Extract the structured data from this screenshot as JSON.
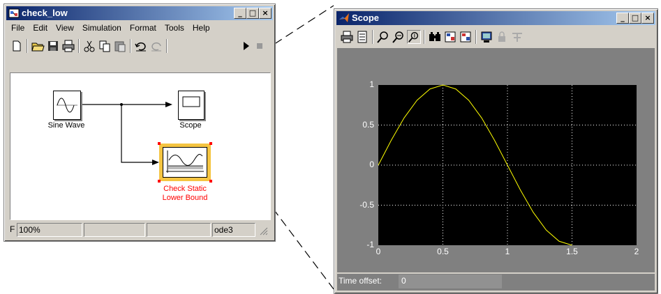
{
  "model_window": {
    "title": "check_low",
    "menu": [
      "File",
      "Edit",
      "View",
      "Simulation",
      "Format",
      "Tools",
      "Help"
    ],
    "blocks": {
      "sine_wave": "Sine Wave",
      "scope": "Scope",
      "check_line1": "Check Static",
      "check_line2": "Lower Bound"
    },
    "status": {
      "prefix": "F",
      "zoom": "100%",
      "solver": "ode3"
    }
  },
  "scope_window": {
    "title": "Scope",
    "time_offset_label": "Time offset:",
    "time_offset_value": "0"
  },
  "window_buttons": {
    "minimize": "_",
    "maximize": "□",
    "close": "×"
  },
  "colors": {
    "plot_bg": "#000000",
    "trace": "#ffff00",
    "titlebar": "#0a246a",
    "selected_block": "#ff0000"
  },
  "chart_data": {
    "type": "line",
    "title": "",
    "xlabel": "",
    "ylabel": "",
    "xlim": [
      0,
      2
    ],
    "ylim": [
      -1,
      1
    ],
    "xticks": [
      "0",
      "0.5",
      "1",
      "1.5",
      "2"
    ],
    "yticks": [
      "1",
      "0.5",
      "0",
      "-0.5",
      "-1"
    ],
    "grid": true,
    "series": [
      {
        "color": "#ffff00",
        "x": [
          0,
          0.1,
          0.2,
          0.3,
          0.4,
          0.5,
          0.6,
          0.7,
          0.8,
          0.9,
          1.0,
          1.1,
          1.2,
          1.3,
          1.4,
          1.5
        ],
        "y": [
          0,
          0.31,
          0.59,
          0.81,
          0.95,
          1.0,
          0.95,
          0.81,
          0.59,
          0.31,
          0,
          -0.31,
          -0.59,
          -0.81,
          -0.95,
          -1.0
        ]
      }
    ]
  }
}
